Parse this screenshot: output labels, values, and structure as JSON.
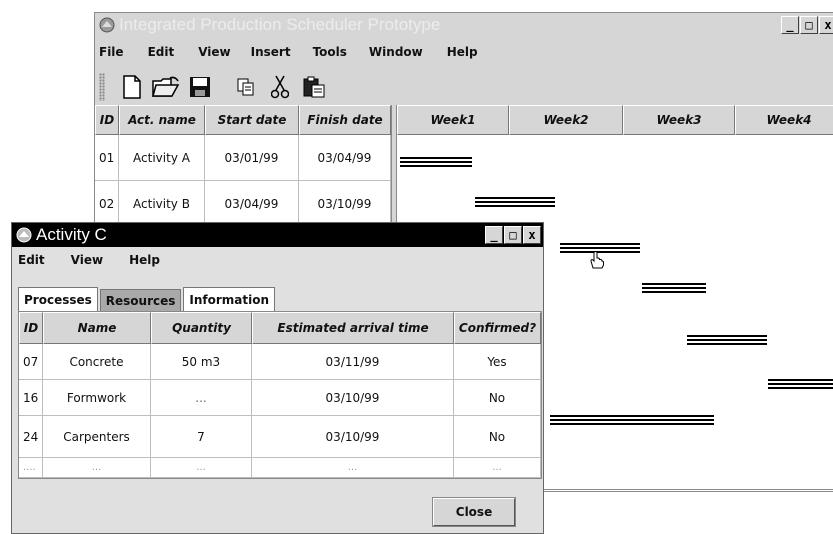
{
  "main_window": {
    "title": "Integrated Production Scheduler Prototype",
    "menus": [
      "File",
      "Edit",
      "View",
      "Insert",
      "Tools",
      "Window",
      "Help"
    ],
    "toolbar_icons": [
      "new-document-icon",
      "open-folder-icon",
      "save-icon",
      "copy-icon",
      "cut-icon",
      "paste-icon"
    ],
    "columns": [
      "ID",
      "Act. name",
      "Start date",
      "Finish date"
    ],
    "weeks": [
      "Week1",
      "Week2",
      "Week3",
      "Week4"
    ],
    "rows": [
      {
        "id": "01",
        "name": "Activity A",
        "start": "03/01/99",
        "finish": "03/04/99"
      },
      {
        "id": "02",
        "name": "Activity B",
        "start": "03/04/99",
        "finish": "03/10/99"
      }
    ]
  },
  "dialog": {
    "title": "Activity C",
    "menus": [
      "Edit",
      "View",
      "Help"
    ],
    "tabs": [
      "Processes",
      "Resources",
      "Information"
    ],
    "selected_tab": "Processes",
    "columns": [
      "ID",
      "Name",
      "Quantity",
      "Estimated arrival time",
      "Confirmed?"
    ],
    "rows": [
      {
        "id": "07",
        "name": "Concrete",
        "quantity": "50 m3",
        "arrival": "03/11/99",
        "confirmed": "Yes"
      },
      {
        "id": "16",
        "name": "Formwork",
        "quantity": "...",
        "arrival": "03/10/99",
        "confirmed": "No"
      },
      {
        "id": "24",
        "name": "Carpenters",
        "quantity": "7",
        "arrival": "03/10/99",
        "confirmed": "No"
      },
      {
        "id": "....",
        "name": "...",
        "quantity": "...",
        "arrival": "...",
        "confirmed": "..."
      }
    ],
    "close_label": "Close"
  },
  "window_buttons": {
    "minimize": "_",
    "maximize": "□",
    "close": "x"
  }
}
